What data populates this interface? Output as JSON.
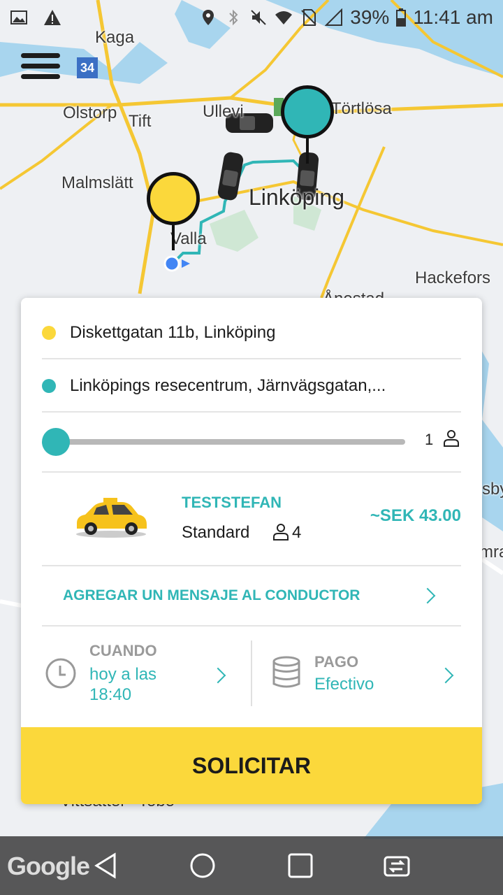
{
  "status_bar": {
    "battery": "39%",
    "time": "11:41 am"
  },
  "map": {
    "labels": [
      "Kaga",
      "Olstorp",
      "Tift",
      "Ullevi",
      "Törtlösa",
      "Malmslätt",
      "Linköping",
      "Valla",
      "Hackefors",
      "Ånestad",
      "sby",
      "mra",
      "Vittsätter",
      "Tobo"
    ],
    "road_badge": "34",
    "colors": {
      "pickup": "#fbd83b",
      "destination": "#30b6b6",
      "route": "#30b6b6",
      "water": "#a8d5ee",
      "road": "#f5c733"
    }
  },
  "ride": {
    "pickup": "Diskettgatan 11b, Linköping",
    "destination": "Linköpings resecentrum, Järnvägsgatan,...",
    "seats": "1"
  },
  "vehicle": {
    "company": "TESTSTEFAN",
    "class": "Standard",
    "capacity": "4",
    "fare": "~SEK 43.00"
  },
  "message": {
    "label": "AGREGAR UN MENSAJE AL CONDUCTOR"
  },
  "when": {
    "label": "CUANDO",
    "value_line1": "hoy a las",
    "value_line2": "18:40"
  },
  "payment": {
    "label": "PAGO",
    "value": "Efectivo"
  },
  "actions": {
    "submit": "SOLICITAR"
  },
  "nav": {
    "brand": "Google"
  }
}
